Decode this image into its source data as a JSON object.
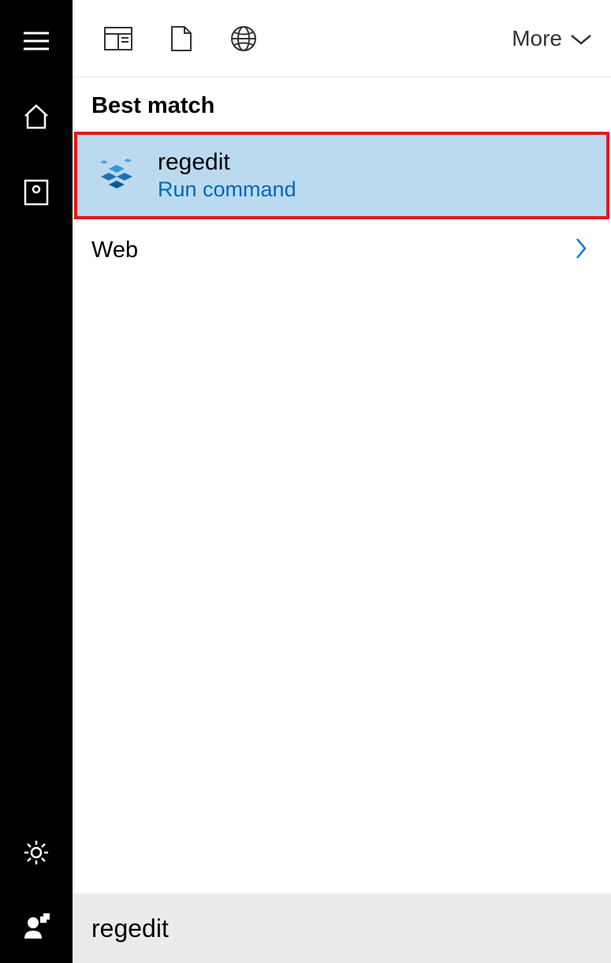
{
  "toolbar": {
    "more_label": "More"
  },
  "sections": {
    "best_match_label": "Best match",
    "web_label": "Web"
  },
  "best_match": {
    "title": "regedit",
    "subtitle": "Run command"
  },
  "search": {
    "value": "regedit"
  }
}
